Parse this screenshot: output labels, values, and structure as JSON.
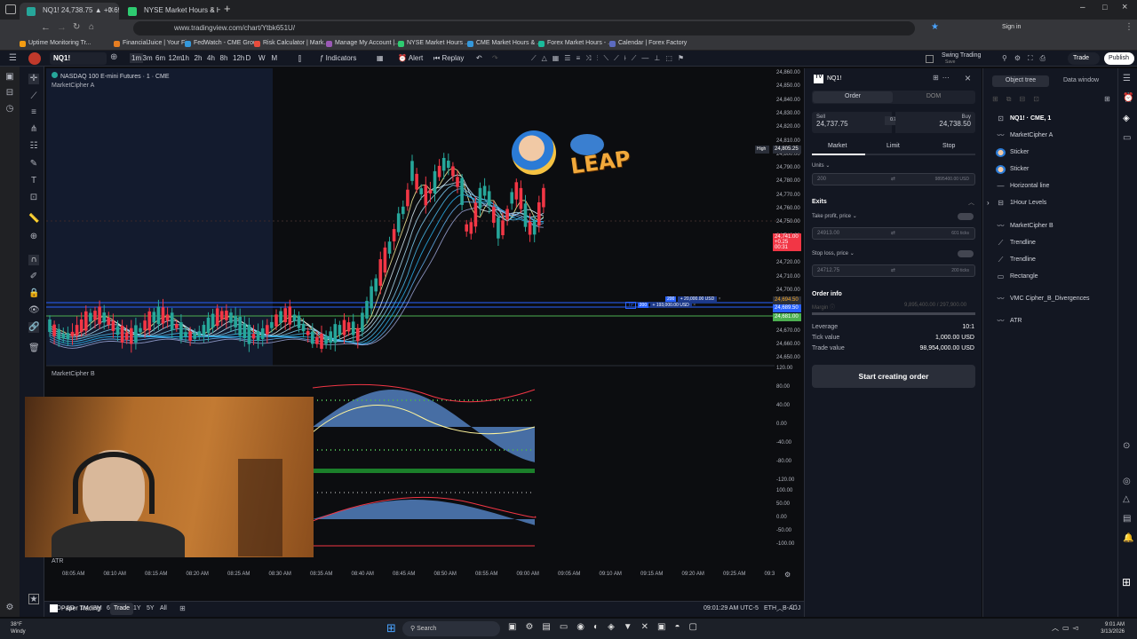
{
  "browser": {
    "tabs": [
      {
        "title": "NQ1! 24,738.75 ▲ +0.69% Swi",
        "active": true,
        "color": "#26a69a"
      },
      {
        "title": "NYSE Market Hours & Holiday",
        "active": false,
        "color": "#2ecc71"
      }
    ],
    "url": "www.tradingview.com/chart/Ytbk651U/",
    "profile_initial": "",
    "signin": "Sign in",
    "bookmarks": [
      {
        "label": "Uptime Monitoring Tr...",
        "color": "#f39c12"
      },
      {
        "label": "FinancialJuice | Your Fi...",
        "color": "#e67e22"
      },
      {
        "label": "FedWatch - CME Group",
        "color": "#3498db"
      },
      {
        "label": "Risk Calculator | Mark...",
        "color": "#e74c3c"
      },
      {
        "label": "Manage My Account |...",
        "color": "#9b59b6"
      },
      {
        "label": "NYSE Market Hours ...",
        "color": "#2ecc71"
      },
      {
        "label": "CME Market Hours & ...",
        "color": "#3498db"
      },
      {
        "label": "Forex Market Hours - ...",
        "color": "#1abc9c"
      },
      {
        "label": "Calendar | Forex Factory",
        "color": "#5c6bc0"
      }
    ]
  },
  "toolbar": {
    "symbol": "NQ1!",
    "intervals": [
      "1m",
      "3m",
      "6m",
      "12m",
      "1h",
      "2h",
      "4h",
      "8h",
      "12h",
      "D",
      "W",
      "M"
    ],
    "indicators": "Indicators",
    "alert": "Alert",
    "replay": "Replay",
    "layout_name": "Swing Trading",
    "layout_sub": "Save",
    "trade": "Trade",
    "publish": "Publish"
  },
  "chart": {
    "title": "NASDAQ 100 E-mini Futures · 1 · CME",
    "indicator_a": "MarketCipher A",
    "indicator_b": "MarketCipher B",
    "atr": "ATR",
    "high_label": "High",
    "high_price": "24,805.25",
    "current_price": "24,741.00",
    "current_change": "+0.25",
    "current_time": "00:31",
    "tp_qty": "200",
    "tp_pnl": "+ 20,000.00 USD",
    "sl_qty": "200",
    "sl_pnl": "+ 193,000.00 USD",
    "tp_tag": "TP",
    "line_price_1": "24,694.50",
    "line_price_2": "24,689.50",
    "line_price_3": "24,681.00",
    "price_ticks": [
      "24,860.00",
      "24,850.00",
      "24,840.00",
      "24,830.00",
      "24,820.00",
      "24,810.00",
      "24,800.00",
      "24,790.00",
      "24,780.00",
      "24,770.00",
      "24,760.00",
      "24,750.00",
      "24,740.00",
      "24,730.00",
      "24,720.00",
      "24,710.00",
      "24,700.00",
      "24,690.00",
      "24,680.00",
      "24,670.00",
      "24,660.00",
      "24,650.00"
    ],
    "osc_ticks": [
      "120.00",
      "80.00",
      "40.00",
      "0.00",
      "-40.00",
      "-80.00",
      "-120.00"
    ],
    "osc2_ticks": [
      "100.00",
      "50.00",
      "0.00",
      "-50.00",
      "-100.00"
    ],
    "time_ticks": [
      "08:05 AM",
      "08:10 AM",
      "08:15 AM",
      "08:20 AM",
      "08:25 AM",
      "08:30 AM",
      "08:35 AM",
      "08:40 AM",
      "08:45 AM",
      "08:50 AM",
      "08:55 AM",
      "09:00 AM",
      "09:05 AM",
      "09:10 AM",
      "09:15 AM",
      "09:20 AM",
      "09:25 AM",
      "09:3"
    ],
    "sticker_text": "LEAP"
  },
  "bottom": {
    "ranges": [
      "1D",
      "5D",
      "1M",
      "3M",
      "6M",
      "YTD",
      "1Y",
      "5Y",
      "All"
    ],
    "clock": "09:01:29 AM UTC-5",
    "session": "ETH",
    "badj": "B-ADJ",
    "paper": "Paper Trading",
    "trade": "Trade"
  },
  "order": {
    "symbol": "NQ1!",
    "tab_order": "Order",
    "tab_dom": "DOM",
    "sell_label": "Sell",
    "sell_price": "24,737.75",
    "spread": "0.75",
    "buy_label": "Buy",
    "buy_price": "24,738.50",
    "types": [
      "Market",
      "Limit",
      "Stop"
    ],
    "units_label": "Units",
    "units_value": "200",
    "units_usd": "9895400.00 USD",
    "exits": "Exits",
    "tp_label": "Take profit, price",
    "tp_value": "24913.00",
    "tp_ticks": "601 ticks",
    "sl_label": "Stop loss, price",
    "sl_value": "24712.75",
    "sl_ticks": "200 ticks",
    "info_title": "Order info",
    "margin_label": "Margin",
    "margin_value": "9,895,400.00 / 297,900.00",
    "leverage_label": "Leverage",
    "leverage_value": "10:1",
    "tick_label": "Tick value",
    "tick_value": "1,000.00 USD",
    "trade_label": "Trade value",
    "trade_value": "98,954,000.00 USD",
    "start_btn": "Start creating order"
  },
  "objtree": {
    "tab1": "Object tree",
    "tab2": "Data window",
    "items": [
      "NQ1! · CME, 1",
      "MarketCipher A",
      "Sticker",
      "Sticker",
      "Horizontal line",
      "1Hour Levels",
      "MarketCipher B",
      "Trendline",
      "Trendline",
      "Rectangle",
      "VMC Cipher_B_Divergences",
      "ATR"
    ]
  },
  "taskbar": {
    "temp": "38°F",
    "weather": "Windy",
    "search": "Search",
    "time": "9:01 AM",
    "date": "3/13/2026"
  }
}
